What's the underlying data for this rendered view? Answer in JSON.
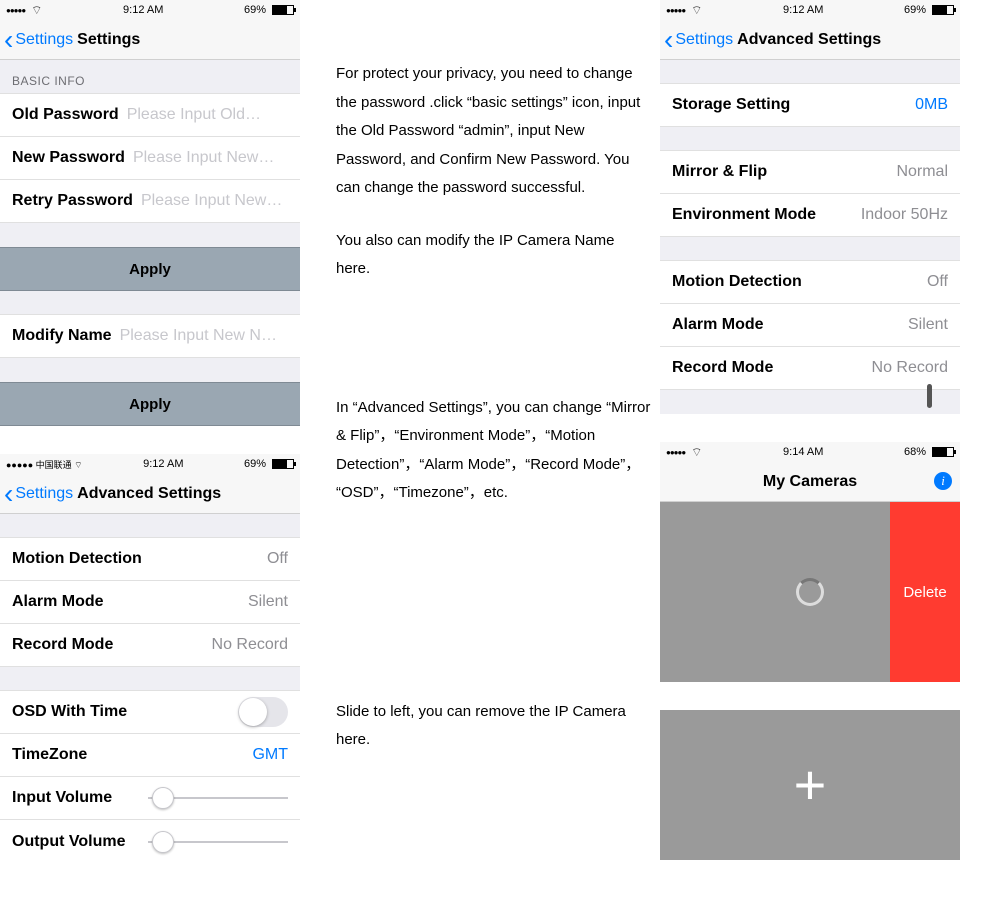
{
  "statusbar": {
    "time_912": "9:12 AM",
    "time_914": "9:14 AM",
    "batt_69": "69%",
    "batt_68": "68%",
    "carrier_cn": "●●●●● 中国联通"
  },
  "shot1": {
    "back": "Settings",
    "title": "Settings",
    "section": "BASIC INFO",
    "old_pw_label": "Old Password",
    "old_pw_ph": "Please Input Old…",
    "new_pw_label": "New Password",
    "new_pw_ph": "Please Input New…",
    "retry_pw_label": "Retry Password",
    "retry_pw_ph": "Please Input New…",
    "apply": "Apply",
    "modify_label": "Modify Name",
    "modify_ph": "Please Input New N…"
  },
  "shot2": {
    "back": "Settings",
    "title": "Advanced Settings",
    "motion_label": "Motion Detection",
    "motion_val": "Off",
    "alarm_label": "Alarm Mode",
    "alarm_val": "Silent",
    "record_label": "Record Mode",
    "record_val": "No Record",
    "osd_label": "OSD With Time",
    "tz_label": "TimeZone",
    "tz_val": "GMT",
    "inv_label": "Input Volume",
    "outv_label": "Output Volume"
  },
  "shot3": {
    "back": "Settings",
    "title": "Advanced Settings",
    "storage_label": "Storage Setting",
    "storage_val": "0MB",
    "mirror_label": "Mirror & Flip",
    "mirror_val": "Normal",
    "env_label": "Environment Mode",
    "env_val": "Indoor 50Hz",
    "motion_label": "Motion Detection",
    "motion_val": "Off",
    "alarm_label": "Alarm Mode",
    "alarm_val": "Silent",
    "record_label": "Record Mode",
    "record_val": "No Record"
  },
  "shot4": {
    "title": "My Cameras",
    "delete": "Delete"
  },
  "instr": {
    "p1": "For protect your privacy, you need to change the password .click “basic settings” icon, input the Old Password “admin”, input New Password, and Confirm New Password. You can change the password successful.",
    "p2": "You also can modify the IP Camera Name here.",
    "p3": "In “Advanced Settings”, you can change “Mirror & Flip”，“Environment Mode”，“Motion Detection”，“Alarm Mode”，“Record Mode”， “OSD”，“Timezone”，etc.",
    "p4": "Slide to left, you can remove the IP Camera here."
  }
}
